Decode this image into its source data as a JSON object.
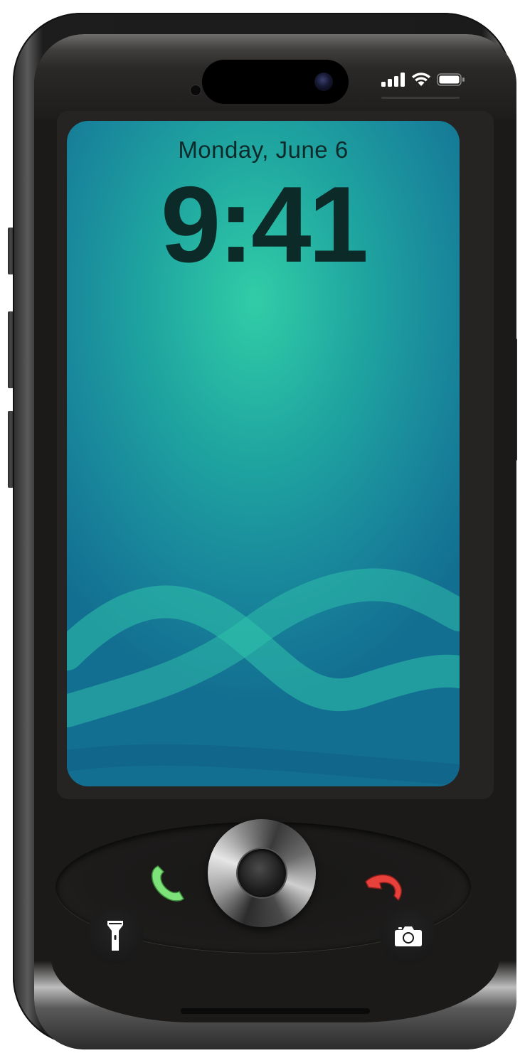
{
  "status_bar": {
    "signal_icon": "cellular-signal-icon",
    "wifi_icon": "wifi-icon",
    "battery_icon": "battery-icon"
  },
  "lock_screen": {
    "date": "Monday, June 6",
    "time": "9:41"
  },
  "controls": {
    "call_icon": "phone-call-icon",
    "end_call_icon": "phone-end-call-icon",
    "flashlight_icon": "flashlight-icon",
    "camera_icon": "camera-icon",
    "nav_pad_icon": "navigation-pad"
  },
  "colors": {
    "call_green": "#7ee27a",
    "end_red": "#e8403a",
    "wallpaper_teal": "#1fa5a0"
  }
}
